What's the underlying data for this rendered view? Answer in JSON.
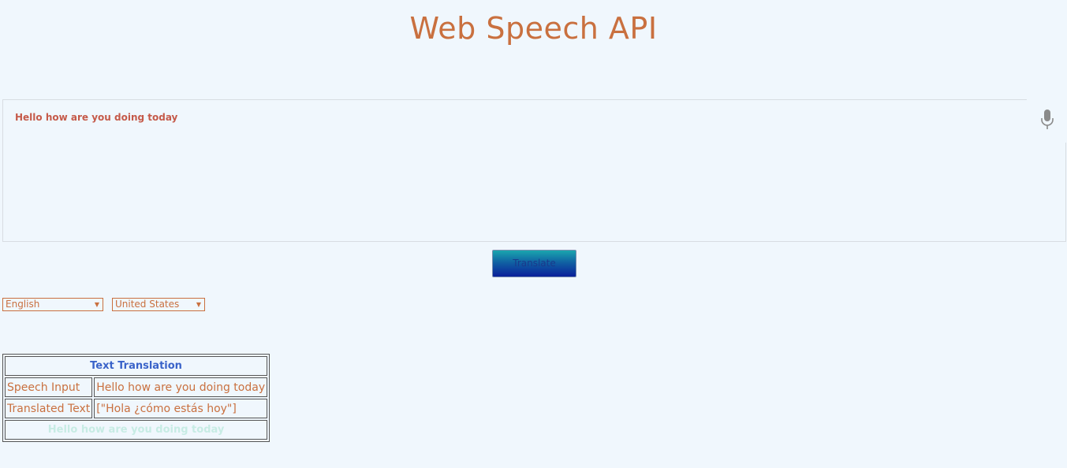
{
  "page": {
    "title": "Web Speech API"
  },
  "speech": {
    "transcript": "Hello how are you doing today",
    "mic_icon": "microphone-icon"
  },
  "actions": {
    "translate_label": "Translate"
  },
  "selects": {
    "language": "English",
    "region": "United States"
  },
  "table": {
    "header": "Text Translation",
    "rows": [
      {
        "label": "Speech Input",
        "value": "Hello how are you doing today"
      },
      {
        "label": "Translated Text",
        "value": "[\"Hola ¿cómo estás hoy\"]"
      }
    ],
    "footer": "Hello how are you doing today"
  },
  "colors": {
    "background": "#f0f7fd",
    "accent": "#c9703f",
    "header_blue": "#3a63c9"
  }
}
